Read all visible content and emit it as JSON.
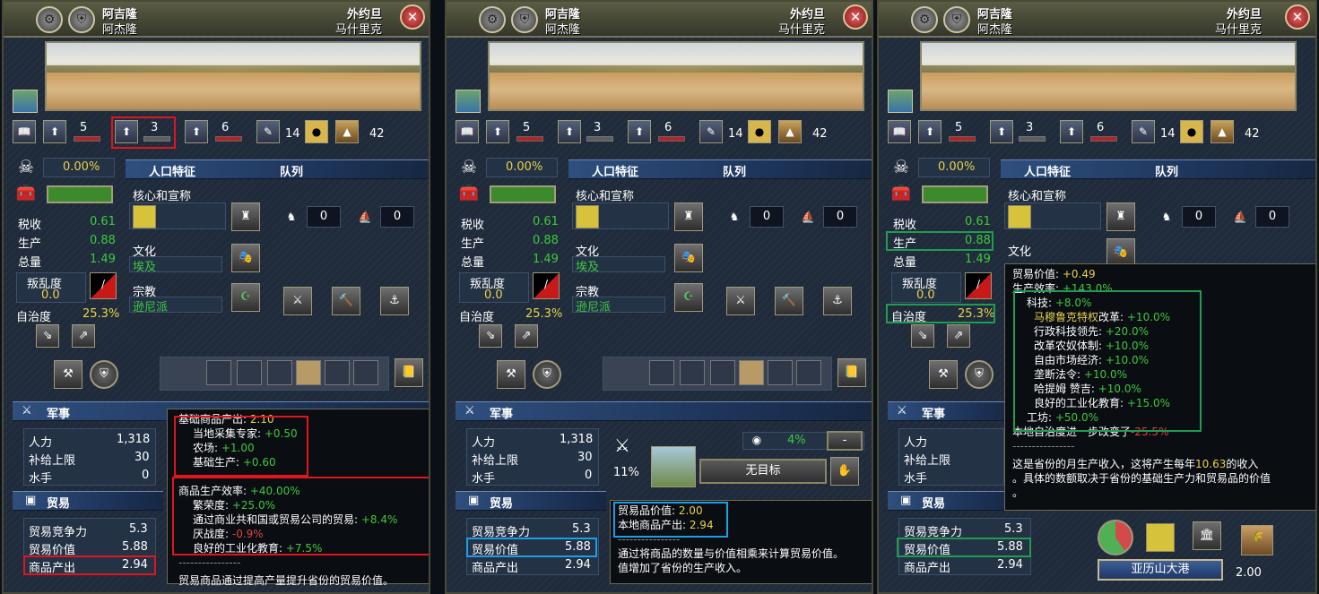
{
  "panels": [
    {
      "province_name": "阿吉隆",
      "province_sub": "阿杰隆",
      "area_name": "外约旦",
      "area_sub": "马什里克",
      "stats": {
        "admin": "5",
        "diplo": "3",
        "mil": "6",
        "manpower_icon_value": "14",
        "dev_total": "42"
      },
      "unrest_pct": "0.00%",
      "tabs": {
        "demographics": "人口特征",
        "queue": "队列"
      },
      "cores_label": "核心和宣称",
      "culture_label": "文化",
      "culture_value": "埃及",
      "religion_label": "宗教",
      "religion_value": "逊尼派",
      "tax_label": "税收",
      "tax_value": "0.61",
      "prod_label": "生产",
      "prod_value": "0.88",
      "total_label": "总量",
      "total_value": "1.49",
      "revolt_label": "叛乱度",
      "revolt_value": "0.0",
      "autonomy_label": "自治度",
      "autonomy_value": "25.3%",
      "unit_counts": [
        "0",
        "0"
      ],
      "military_title": "军事",
      "manpower_label": "人力",
      "manpower_value": "1,318",
      "supply_label": "补给上限",
      "supply_value": "30",
      "sailors_label": "水手",
      "sailors_value": "0",
      "trade_title": "贸易",
      "trade_power_label": "贸易竞争力",
      "trade_power_value": "5.3",
      "trade_value_label": "贸易价值",
      "trade_value_value": "5.88",
      "goods_label": "商品产出",
      "goods_value": "2.94"
    },
    {
      "province_name": "阿吉隆",
      "province_sub": "阿杰隆",
      "area_name": "外约旦",
      "area_sub": "马什里克"
    },
    {
      "province_name": "阿吉隆",
      "province_sub": "阿杰隆",
      "area_name": "外约旦",
      "area_sub": "马什里克"
    }
  ],
  "tooltip1": {
    "base_goods": "基础商品产出: ",
    "base_goods_val": "2.10",
    "local_expert": "当地采集专家: ",
    "local_expert_val": "+0.50",
    "farm": "农场: ",
    "farm_val": "+1.00",
    "base_prod": "基础生产: ",
    "base_prod_val": "+0.60",
    "sep": "----------------",
    "efficiency": "商品生产效率: ",
    "efficiency_val": "+40.00%",
    "prosperity": "繁荣度: ",
    "prosperity_val": "+25.0%",
    "merchant": "通过商业共和国或贸易公司的贸易: ",
    "merchant_val": "+8.4%",
    "war_exhaustion": "厌战度: ",
    "war_exhaustion_val": "-0.9%",
    "industrial": "良好的工业化教育: ",
    "industrial_val": "+7.5%",
    "sep2": "----------------",
    "footer": "贸易商品通过提高产量提升省份的贸易价值。"
  },
  "panel2_mil": {
    "percent": "4%",
    "dash": "-",
    "pct11": "11%",
    "no_target": "无目标"
  },
  "tooltip2": {
    "trade_goods_value": "贸易品价值: ",
    "trade_goods_value_val": "2.00",
    "local_goods": "本地商品产出: ",
    "local_goods_val": "2.94",
    "sep": "----------------",
    "line1": "通过将商品的数量与价值相乘来计算贸易价值。",
    "line2": "值增加了省份的生产收入。"
  },
  "tooltip3": {
    "trade_value": "贸易价值: ",
    "trade_value_val": "+0.49",
    "prod_eff": "生产效率: ",
    "prod_eff_val": "+143.0%",
    "tech": "科技: ",
    "tech_val": "+8.0%",
    "mamluk": "马穆鲁克特权",
    "mamluk_suffix": "改革: ",
    "mamluk_val": "+10.0%",
    "admin_tech": "行政科技领先: ",
    "admin_tech_val": "+20.0%",
    "serfdom": "改革农奴体制: ",
    "serfdom_val": "+10.0%",
    "free_market": "自由市场经济: ",
    "free_market_val": "+10.0%",
    "monopoly": "垄断法令: ",
    "monopoly_val": "+10.0%",
    "hatam": "哈提姆 赞吉: ",
    "hatam_val": "+10.0%",
    "industrial": "良好的工业化教育: ",
    "industrial_val": "+15.0%",
    "workshop": "工坊: ",
    "workshop_val": "+50.0%",
    "autonomy": "本地自治度进一步改变了",
    "autonomy_val": "-25.5%",
    "sep": "----------------",
    "desc1": "这是省份的月生产收入，这将产生每年",
    "desc_val": "10.63",
    "desc2": "的收入",
    "desc3": "。具体的数额取决于省份的基础生产力和贸易品的价值",
    "desc4": "。"
  },
  "panel3_trade": {
    "node": "亚历山大港",
    "income": "2.00"
  }
}
